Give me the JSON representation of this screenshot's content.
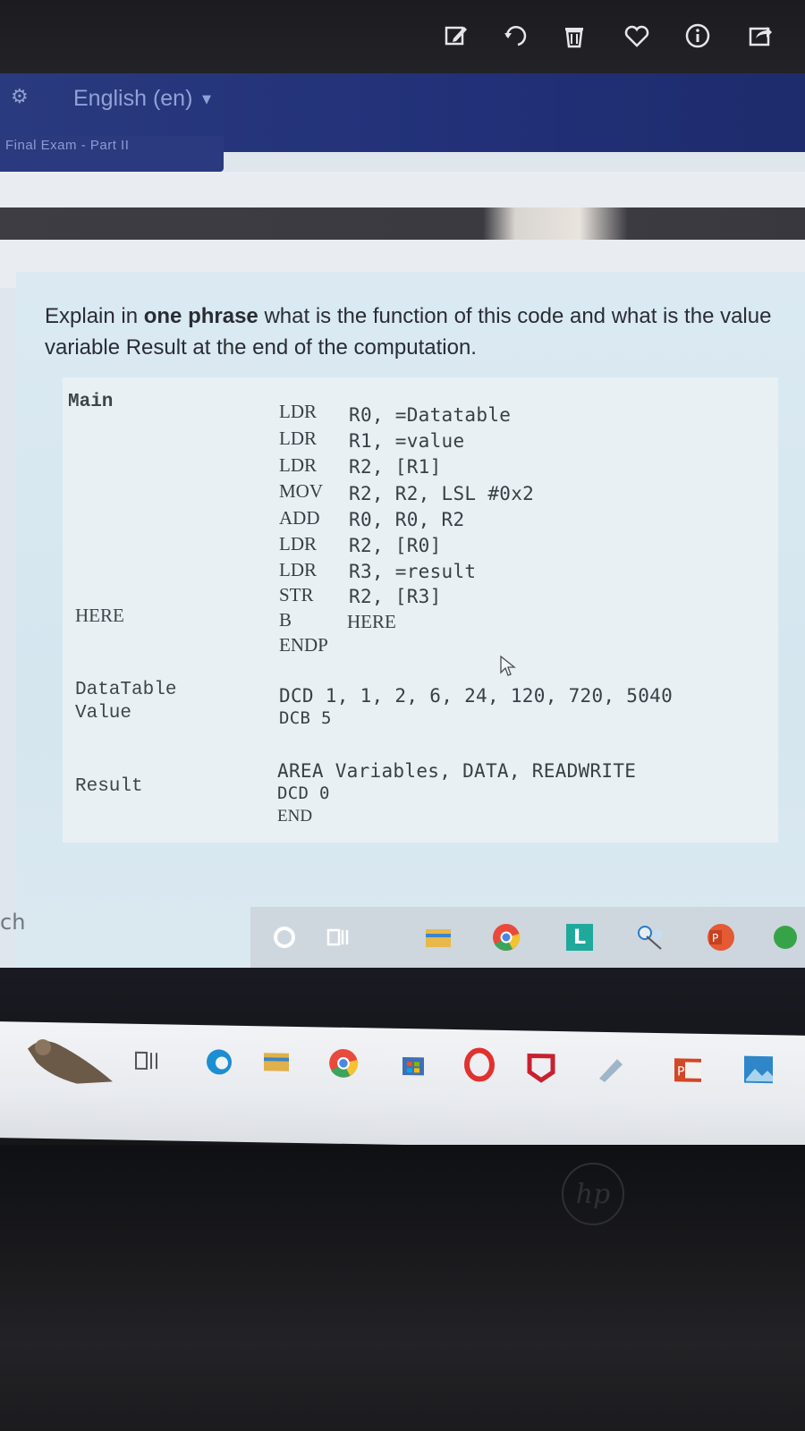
{
  "photo_toolbar": {
    "icons": [
      "edit-icon",
      "rotate-icon",
      "delete-icon",
      "heart-icon",
      "info-icon",
      "share-icon"
    ]
  },
  "lang_bar": {
    "language": "English (en)",
    "breadcrumb": "Final Exam - Part II"
  },
  "question": {
    "prefix": "Explain in ",
    "bold": "one phrase",
    "suffix_line1": " what is the function of this code and what is the value",
    "line2": "variable Result at the end of the computation."
  },
  "code": {
    "labels": {
      "main": "Main",
      "here": "HERE",
      "datatable": "DataTable",
      "value": "Value",
      "result": "Result"
    },
    "lines": [
      {
        "op": "LDR",
        "args": "R0, =Datatable"
      },
      {
        "op": "LDR",
        "args": "R1, =value"
      },
      {
        "op": "LDR",
        "args": "R2, [R1]"
      },
      {
        "op": "MOV",
        "args": "R2, R2, LSL #0x2"
      },
      {
        "op": "ADD",
        "args": "R0, R0, R2"
      },
      {
        "op": "LDR",
        "args": "R2, [R0]"
      },
      {
        "op": "LDR",
        "args": "R3, =result"
      },
      {
        "op": "STR",
        "args": "R2, [R3]"
      },
      {
        "op": "B",
        "args": "HERE"
      },
      {
        "op": "ENDP",
        "args": ""
      }
    ],
    "data_lines": [
      "DCD 1, 1, 2, 6, 24, 120, 720, 5040",
      "DCB 5"
    ],
    "area_line": "AREA Variables, DATA, READWRITE",
    "dcd0": "DCD 0",
    "end": "END"
  },
  "taskbar": {
    "search_hint": "ch"
  },
  "lower": {
    "hp": "hp"
  }
}
